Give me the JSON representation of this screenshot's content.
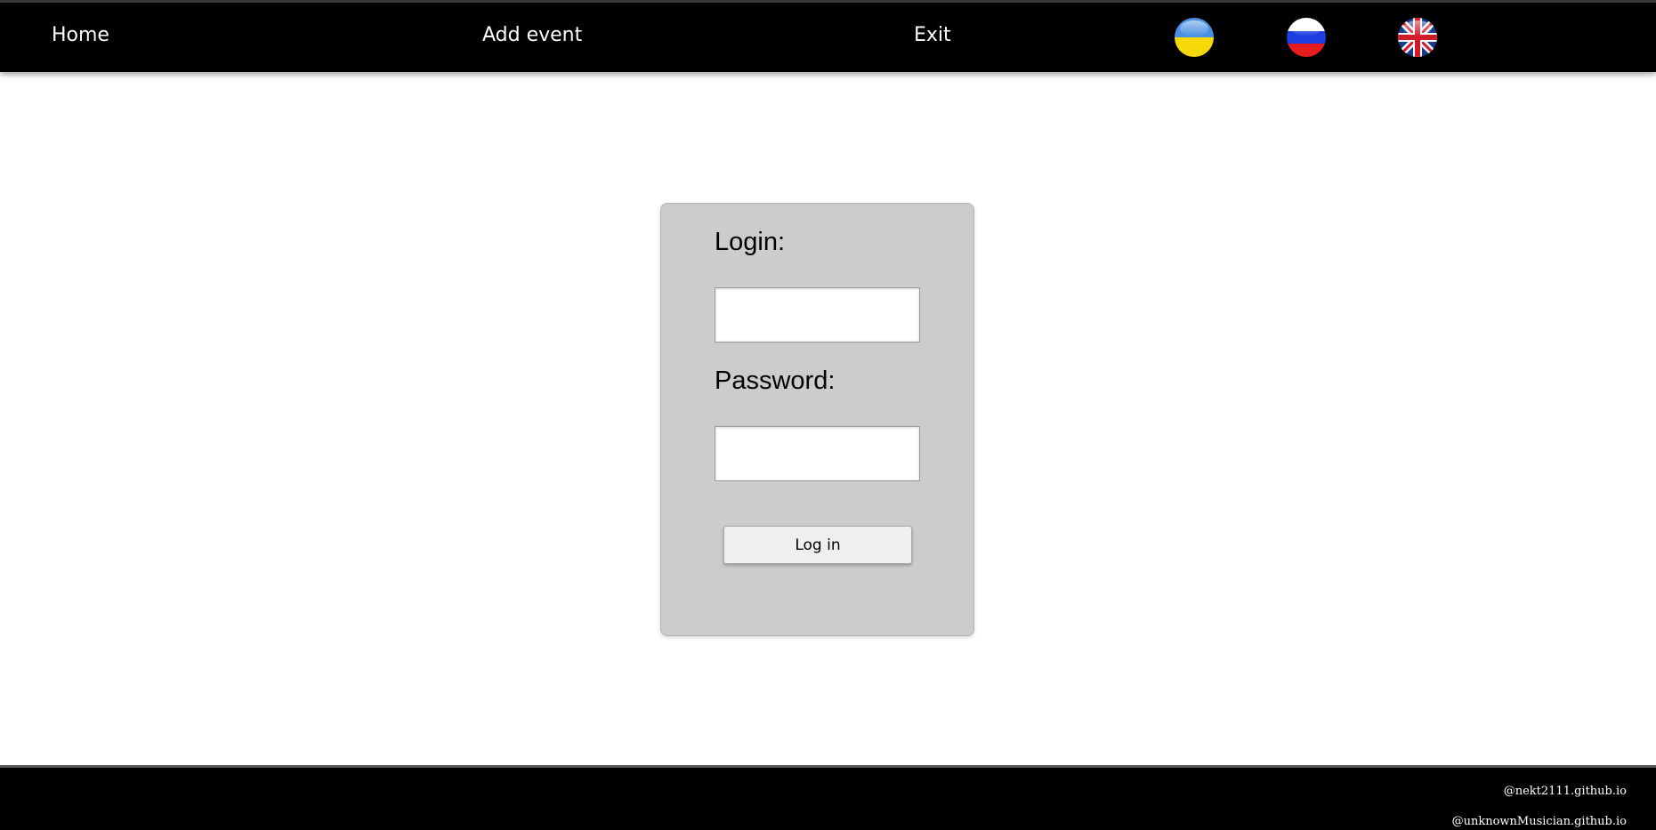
{
  "nav": {
    "home_label": "Home",
    "add_event_label": "Add event",
    "exit_label": "Exit"
  },
  "languages": [
    {
      "name": "ukrainian-flag-icon",
      "colors": [
        "#4a90e2",
        "#f5d90a"
      ]
    },
    {
      "name": "russian-flag-icon",
      "colors": [
        "#ffffff",
        "#1e3de0",
        "#e41c1c"
      ]
    },
    {
      "name": "uk-flag-icon",
      "colors": [
        "#1a3a8c",
        "#ffffff",
        "#d21a2a"
      ]
    }
  ],
  "login_form": {
    "login_label": "Login:",
    "login_value": "",
    "password_label": "Password:",
    "password_value": "",
    "submit_label": "Log in"
  },
  "footer": {
    "links": [
      "@nekt2111.github.io",
      "@unknownMusician.github.io"
    ]
  },
  "colors": {
    "header_bg": "#000000",
    "card_bg": "#cccccc",
    "footer_bg": "#000000"
  }
}
